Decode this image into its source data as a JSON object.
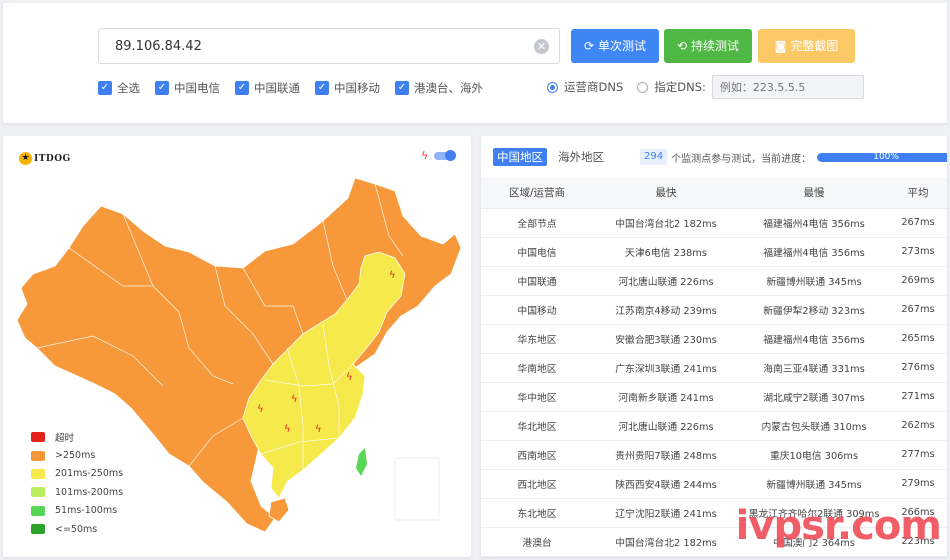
{
  "search": {
    "value": "89.106.84.42"
  },
  "buttons": {
    "single": "单次测试",
    "continuous": "持续测试",
    "screenshot": "完整截图"
  },
  "filters": [
    {
      "label": "全选",
      "checked": true
    },
    {
      "label": "中国电信",
      "checked": true
    },
    {
      "label": "中国联通",
      "checked": true
    },
    {
      "label": "中国移动",
      "checked": true
    },
    {
      "label": "港澳台、海外",
      "checked": true
    }
  ],
  "dns": {
    "option_carrier": "运营商DNS",
    "option_custom": "指定DNS:",
    "placeholder": "例如：223.5.5.5"
  },
  "logo": {
    "text": "ITDOG"
  },
  "legend": [
    {
      "label": "超时",
      "color": "#e3231c"
    },
    {
      "label": ">250ms",
      "color": "#f7993a"
    },
    {
      "label": "201ms-250ms",
      "color": "#f5e94b"
    },
    {
      "label": "101ms-200ms",
      "color": "#b9ef5f"
    },
    {
      "label": "51ms-100ms",
      "color": "#56d655"
    },
    {
      "label": "<=50ms",
      "color": "#2aa52a"
    }
  ],
  "tabs": {
    "domestic": "中国地区",
    "overseas": "海外地区"
  },
  "progress": {
    "count": "294",
    "text": "个监测点参与测试，当前进度：",
    "percent": 100,
    "label": "100%"
  },
  "table": {
    "headers": [
      "区域/运营商",
      "最快",
      "最慢",
      "平均"
    ],
    "rows": [
      [
        "全部节点",
        "中国台湾台北2 182ms",
        "福建福州4电信 356ms",
        "267ms"
      ],
      [
        "中国电信",
        "天津6电信 238ms",
        "福建福州4电信 356ms",
        "273ms"
      ],
      [
        "中国联通",
        "河北唐山联通 226ms",
        "新疆博州联通 345ms",
        "269ms"
      ],
      [
        "中国移动",
        "江苏南京4移动 239ms",
        "新疆伊犁2移动 323ms",
        "267ms"
      ],
      [
        "华东地区",
        "安徽合肥3联通 230ms",
        "福建福州4电信 356ms",
        "265ms"
      ],
      [
        "华南地区",
        "广东深圳3联通 241ms",
        "海南三亚4联通 331ms",
        "276ms"
      ],
      [
        "华中地区",
        "河南新乡联通 241ms",
        "湖北咸宁2联通 307ms",
        "271ms"
      ],
      [
        "华北地区",
        "河北唐山联通 226ms",
        "内蒙古包头联通 310ms",
        "262ms"
      ],
      [
        "西南地区",
        "贵州贵阳7联通 248ms",
        "重庆10电信 306ms",
        "277ms"
      ],
      [
        "西北地区",
        "陕西西安4联通 244ms",
        "新疆博州联通 345ms",
        "279ms"
      ],
      [
        "东北地区",
        "辽宁沈阳2联通 241ms",
        "黑龙江齐齐哈尔2联通 309ms",
        "266ms"
      ],
      [
        "港澳台",
        "中国台湾台北2 182ms",
        "中国澳门2 364ms",
        "223ms"
      ]
    ]
  },
  "watermark": {
    "text": "ivpsr.com"
  },
  "colors": {
    "primary": "#3f7ff1",
    "green": "#4fb845",
    "orange": "#fbc866",
    "map_slow": "#f7993a",
    "map_mid": "#f5e94b"
  }
}
